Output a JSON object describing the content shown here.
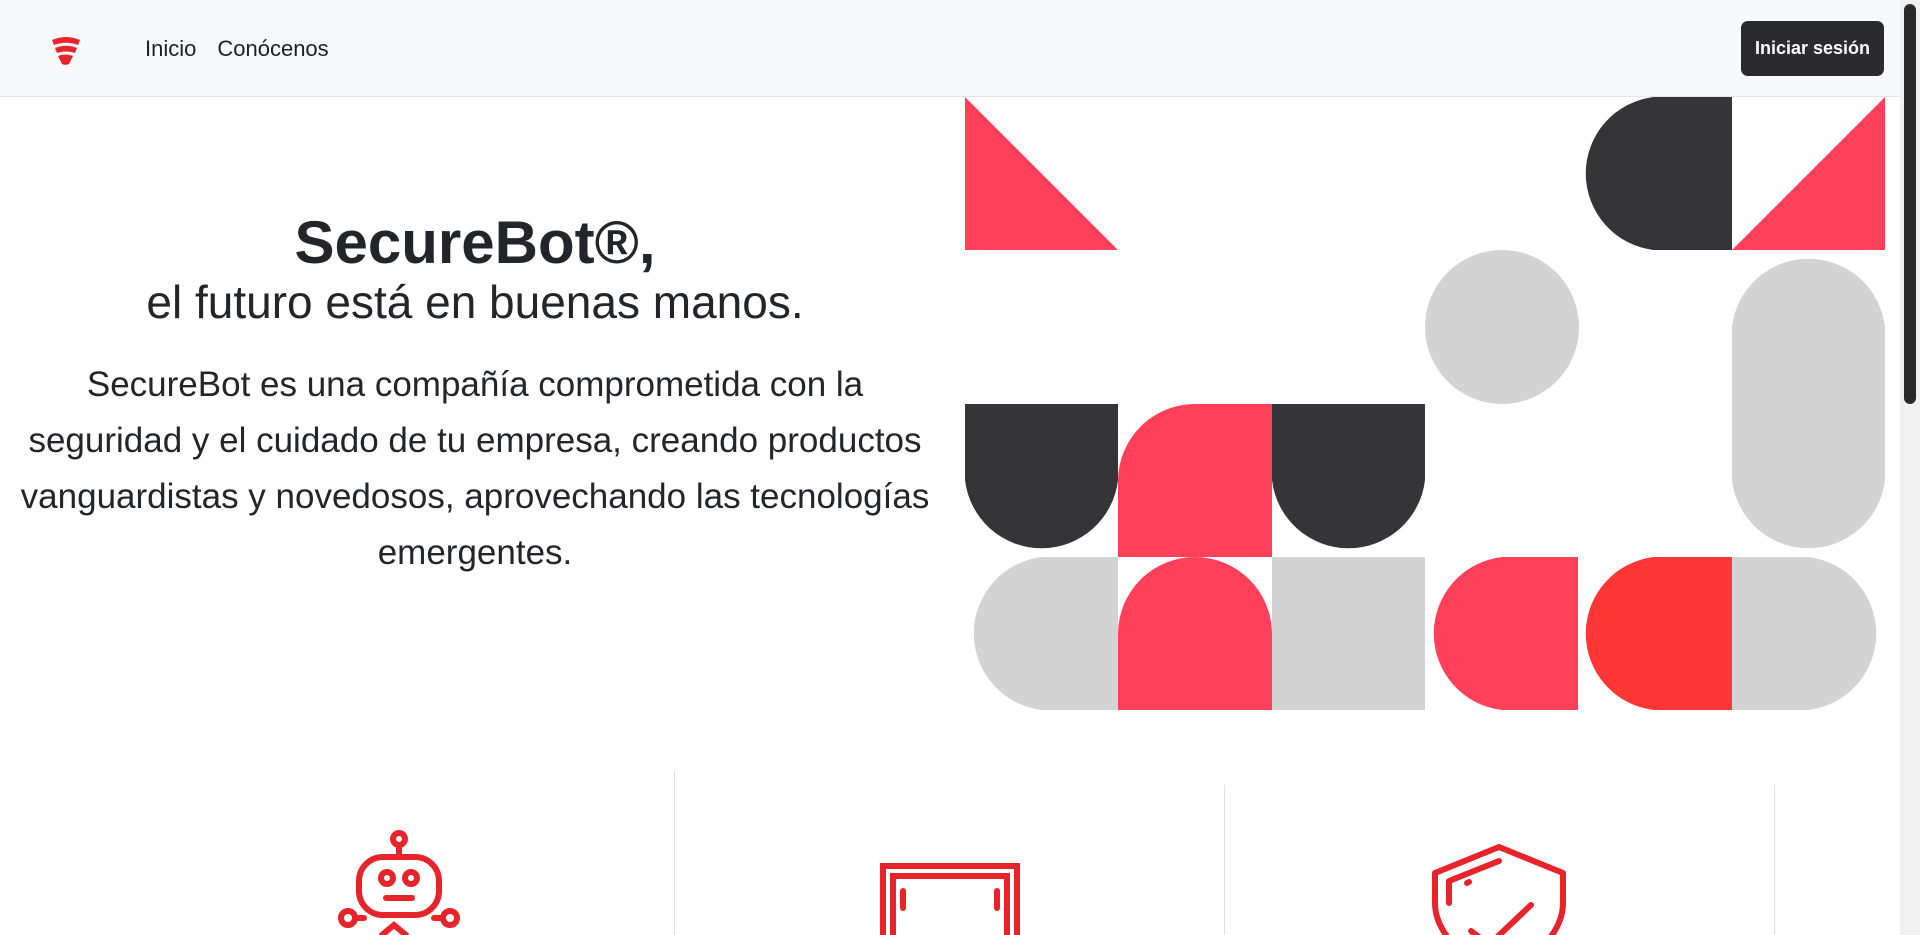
{
  "navbar": {
    "brand_icon": "securebot-logo-icon",
    "links": [
      "Inicio",
      "Conócenos"
    ],
    "login_label": "Iniciar sesión"
  },
  "hero": {
    "title": "SecureBot®,",
    "subtitle": "el futuro está en buenas manos.",
    "description": "SecureBot es una compañía comprometida con la seguridad y el cuidado de tu empresa, creando productos vanguardistas y novedosos, aprovechando las tecnologías emergentes."
  },
  "features": {
    "icons": [
      "robot-icon",
      "screen-frame-icon",
      "shield-check-icon"
    ]
  },
  "colors": {
    "accent_red": "#e8242b",
    "pink": "#ff405b",
    "dark": "#353436",
    "light_gray": "#d3d3d3",
    "bright_red": "#ff3636"
  }
}
